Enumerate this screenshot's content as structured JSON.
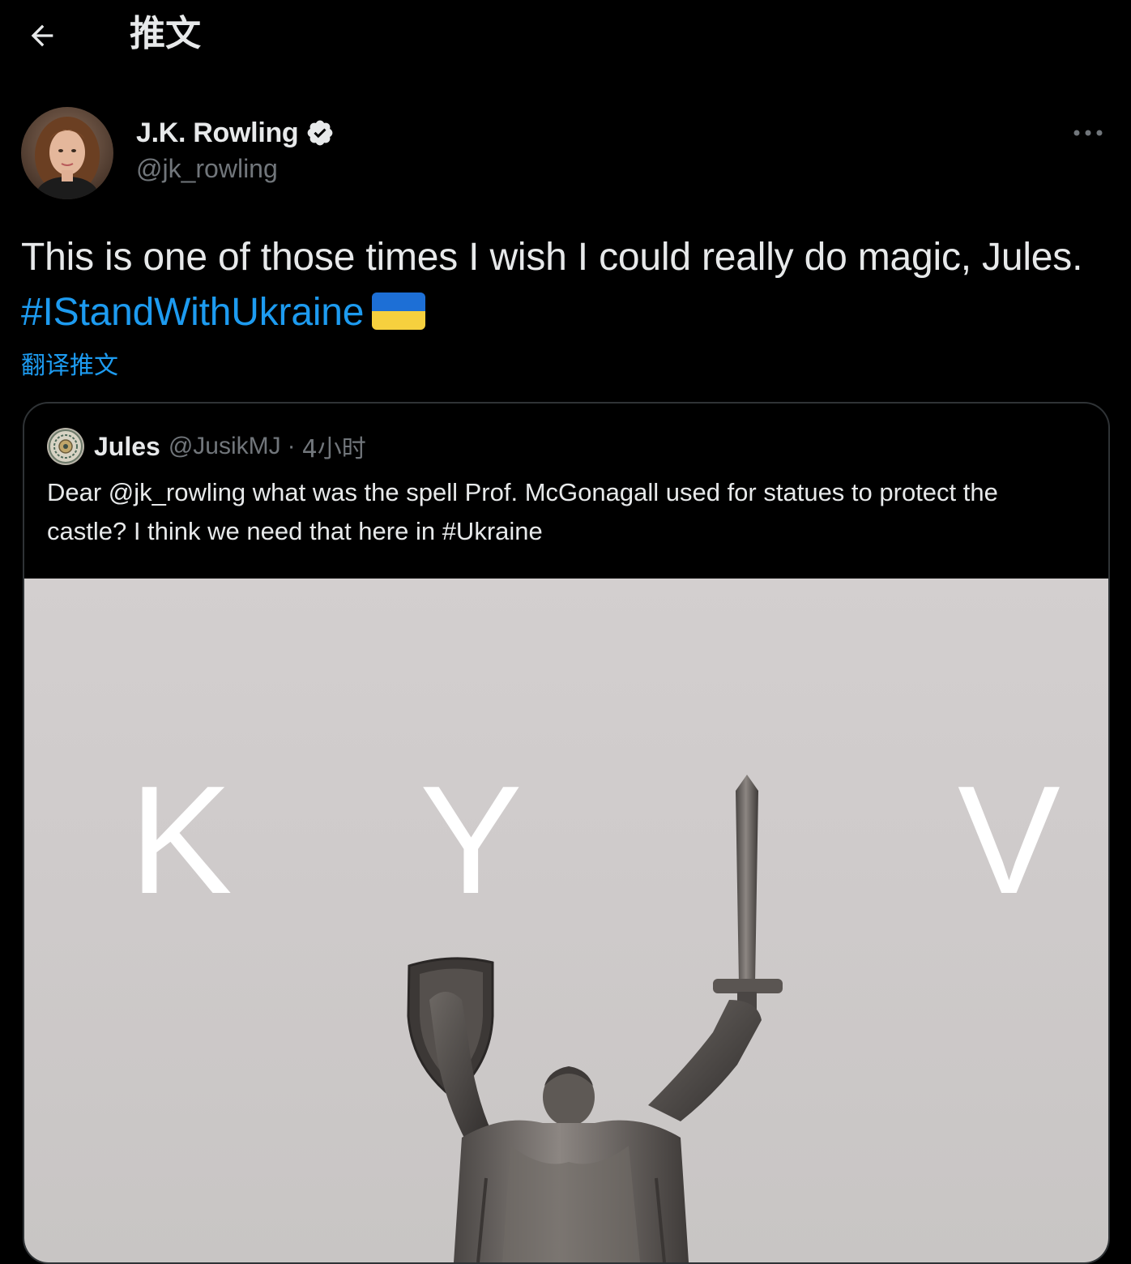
{
  "header": {
    "title": "推文",
    "back_icon": "arrow-left-icon"
  },
  "author": {
    "name": "J.K. Rowling",
    "handle": "@jk_rowling",
    "verified_icon": "verified-badge-icon",
    "more_icon": "more-horizontal-icon"
  },
  "tweet": {
    "text_main": "This is one of those times I wish I could really do magic, Jules.",
    "hashtag": "#IStandWithUkraine",
    "flag_emoji": "ukraine-flag-icon",
    "translate_label": "翻译推文"
  },
  "quote": {
    "name": "Jules",
    "handle": "@JusikMJ",
    "separator": "·",
    "time": "4小时",
    "text": "Dear @jk_rowling what was the spell Prof. McGonagall used for statues to protect the castle? I think we need that here in #Ukraine",
    "image_letters": [
      "K",
      "Y",
      "V"
    ]
  },
  "colors": {
    "accent": "#1d9bf0",
    "text": "#e7e9ea",
    "muted": "#71767b",
    "background": "#000000",
    "border": "#2f3336"
  }
}
